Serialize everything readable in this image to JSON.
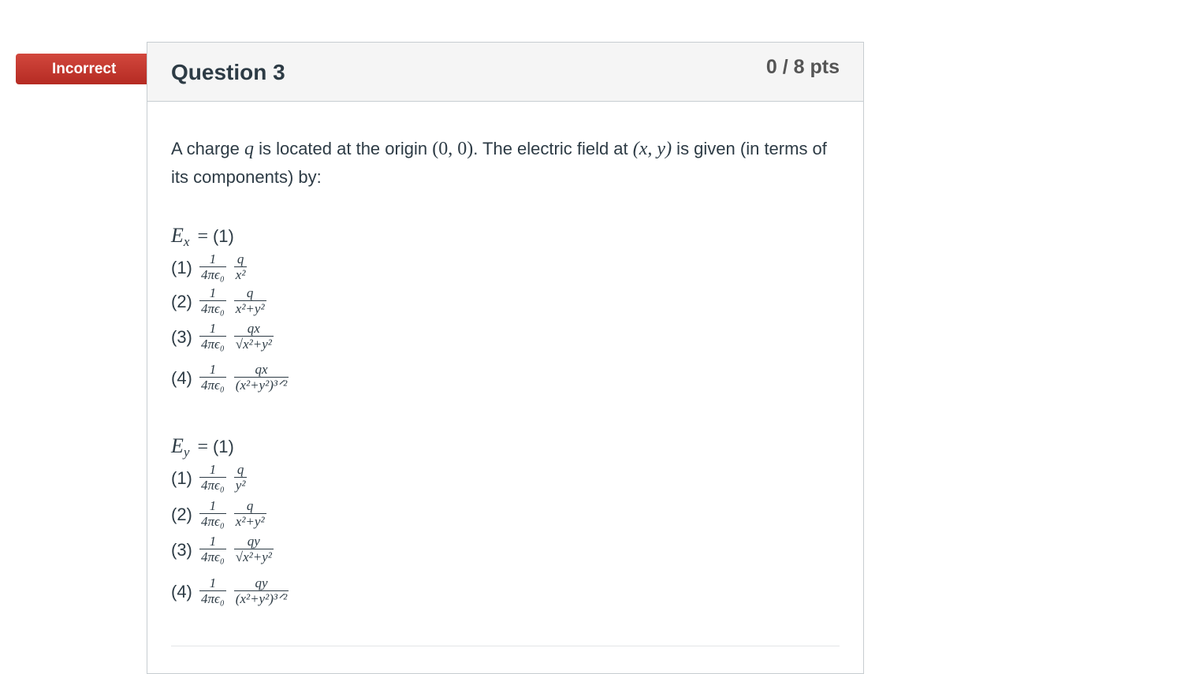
{
  "badge": {
    "label": "Incorrect",
    "color": "#c4352d"
  },
  "question": {
    "title": "Question 3",
    "points": "0 / 8 pts"
  },
  "stem": {
    "t1": "A charge ",
    "q": "q",
    "t2": " is located at the origin ",
    "origin": "(0, 0)",
    "t3": ". The electric field at ",
    "point": "(x, y)",
    "t4": " is given (in terms of its components) by:"
  },
  "blocks": [
    {
      "var": "E",
      "sub": "x",
      "eq": "=",
      "blank": "(1)",
      "options": [
        {
          "num": "(1)",
          "coef_num": "1",
          "coef_den": "4πϵ₀",
          "num2": "q",
          "den2": "x²"
        },
        {
          "num": "(2)",
          "coef_num": "1",
          "coef_den": "4πϵ₀",
          "num2": "q",
          "den2": "x²+y²"
        },
        {
          "num": "(3)",
          "coef_num": "1",
          "coef_den": "4πϵ₀",
          "num2": "qx",
          "den2": "√x²+y²"
        },
        {
          "num": "(4)",
          "coef_num": "1",
          "coef_den": "4πϵ₀",
          "num2": "qx",
          "den2": "(x²+y²)³ᐟ²"
        }
      ]
    },
    {
      "var": "E",
      "sub": "y",
      "eq": "=",
      "blank": "(1)",
      "options": [
        {
          "num": "(1)",
          "coef_num": "1",
          "coef_den": "4πϵ₀",
          "num2": "q",
          "den2": "y²"
        },
        {
          "num": "(2)",
          "coef_num": "1",
          "coef_den": "4πϵ₀",
          "num2": "q",
          "den2": "x²+y²"
        },
        {
          "num": "(3)",
          "coef_num": "1",
          "coef_den": "4πϵ₀",
          "num2": "qy",
          "den2": "√x²+y²"
        },
        {
          "num": "(4)",
          "coef_num": "1",
          "coef_den": "4πϵ₀",
          "num2": "qy",
          "den2": "(x²+y²)³ᐟ²"
        }
      ]
    }
  ]
}
